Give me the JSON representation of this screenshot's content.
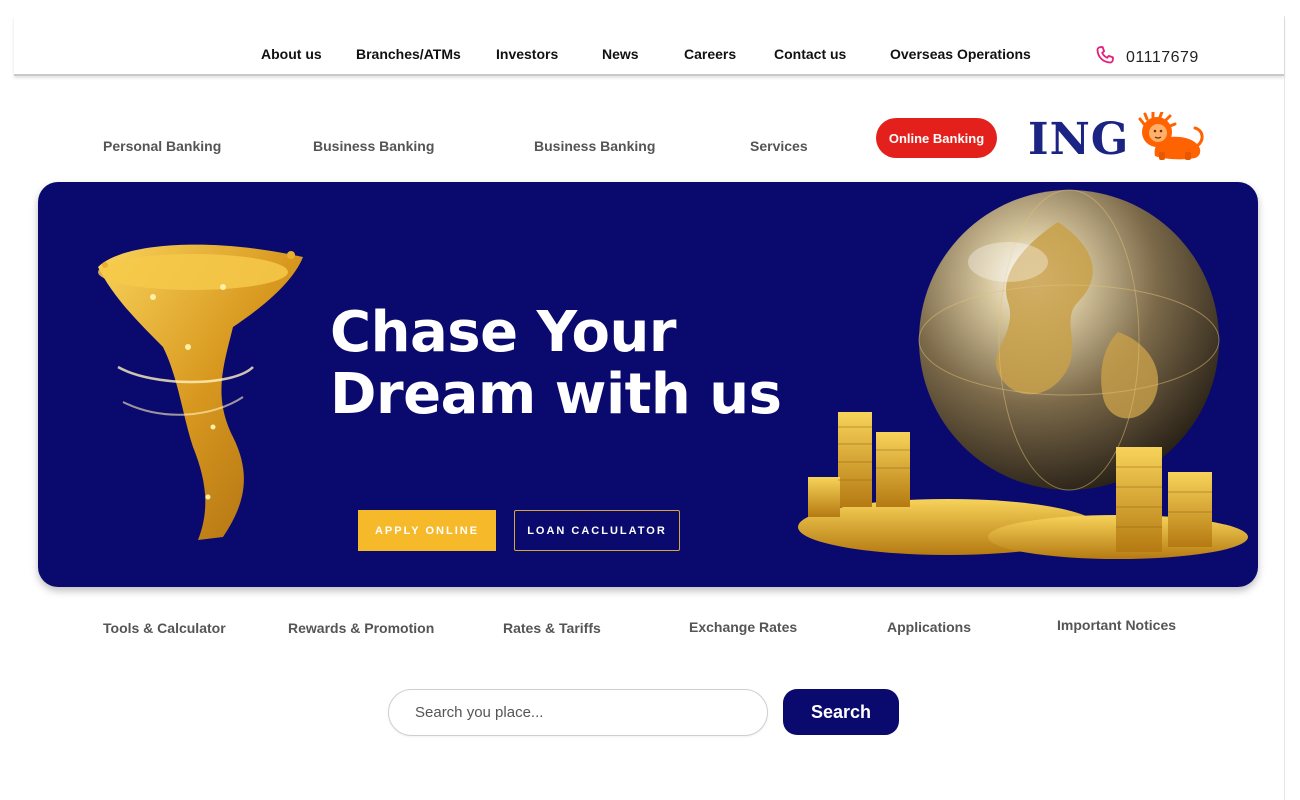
{
  "top_nav": {
    "items": [
      "About us",
      "Branches/ATMs",
      "Investors",
      "News",
      "Careers",
      "Contact us",
      "Overseas Operations"
    ],
    "phone_icon": "phone-icon",
    "phone": "01117679"
  },
  "main_nav": {
    "items": [
      "Personal Banking",
      "Business Banking",
      "Business Banking",
      "Services"
    ],
    "online_banking": "Online Banking",
    "logo_text": "ING",
    "logo_icon": "lion-icon"
  },
  "hero": {
    "title_line1": "Chase Your",
    "title_line2": "Dream with us",
    "apply_label": "APPLY ONLINE",
    "loan_label": "LOAN CACLULATOR",
    "background": "#0a0a6e",
    "accent": "#f5b92a"
  },
  "sub_nav": {
    "items": [
      "Tools & Calculator",
      "Rewards & Promotion",
      "Rates & Tariffs",
      "Exchange Rates",
      "Applications",
      "Important Notices"
    ]
  },
  "search": {
    "placeholder": "Search you place...",
    "button_label": "Search"
  },
  "colors": {
    "brand_blue": "#1c2483",
    "brand_orange": "#ff6200",
    "online_red": "#e3201b"
  }
}
